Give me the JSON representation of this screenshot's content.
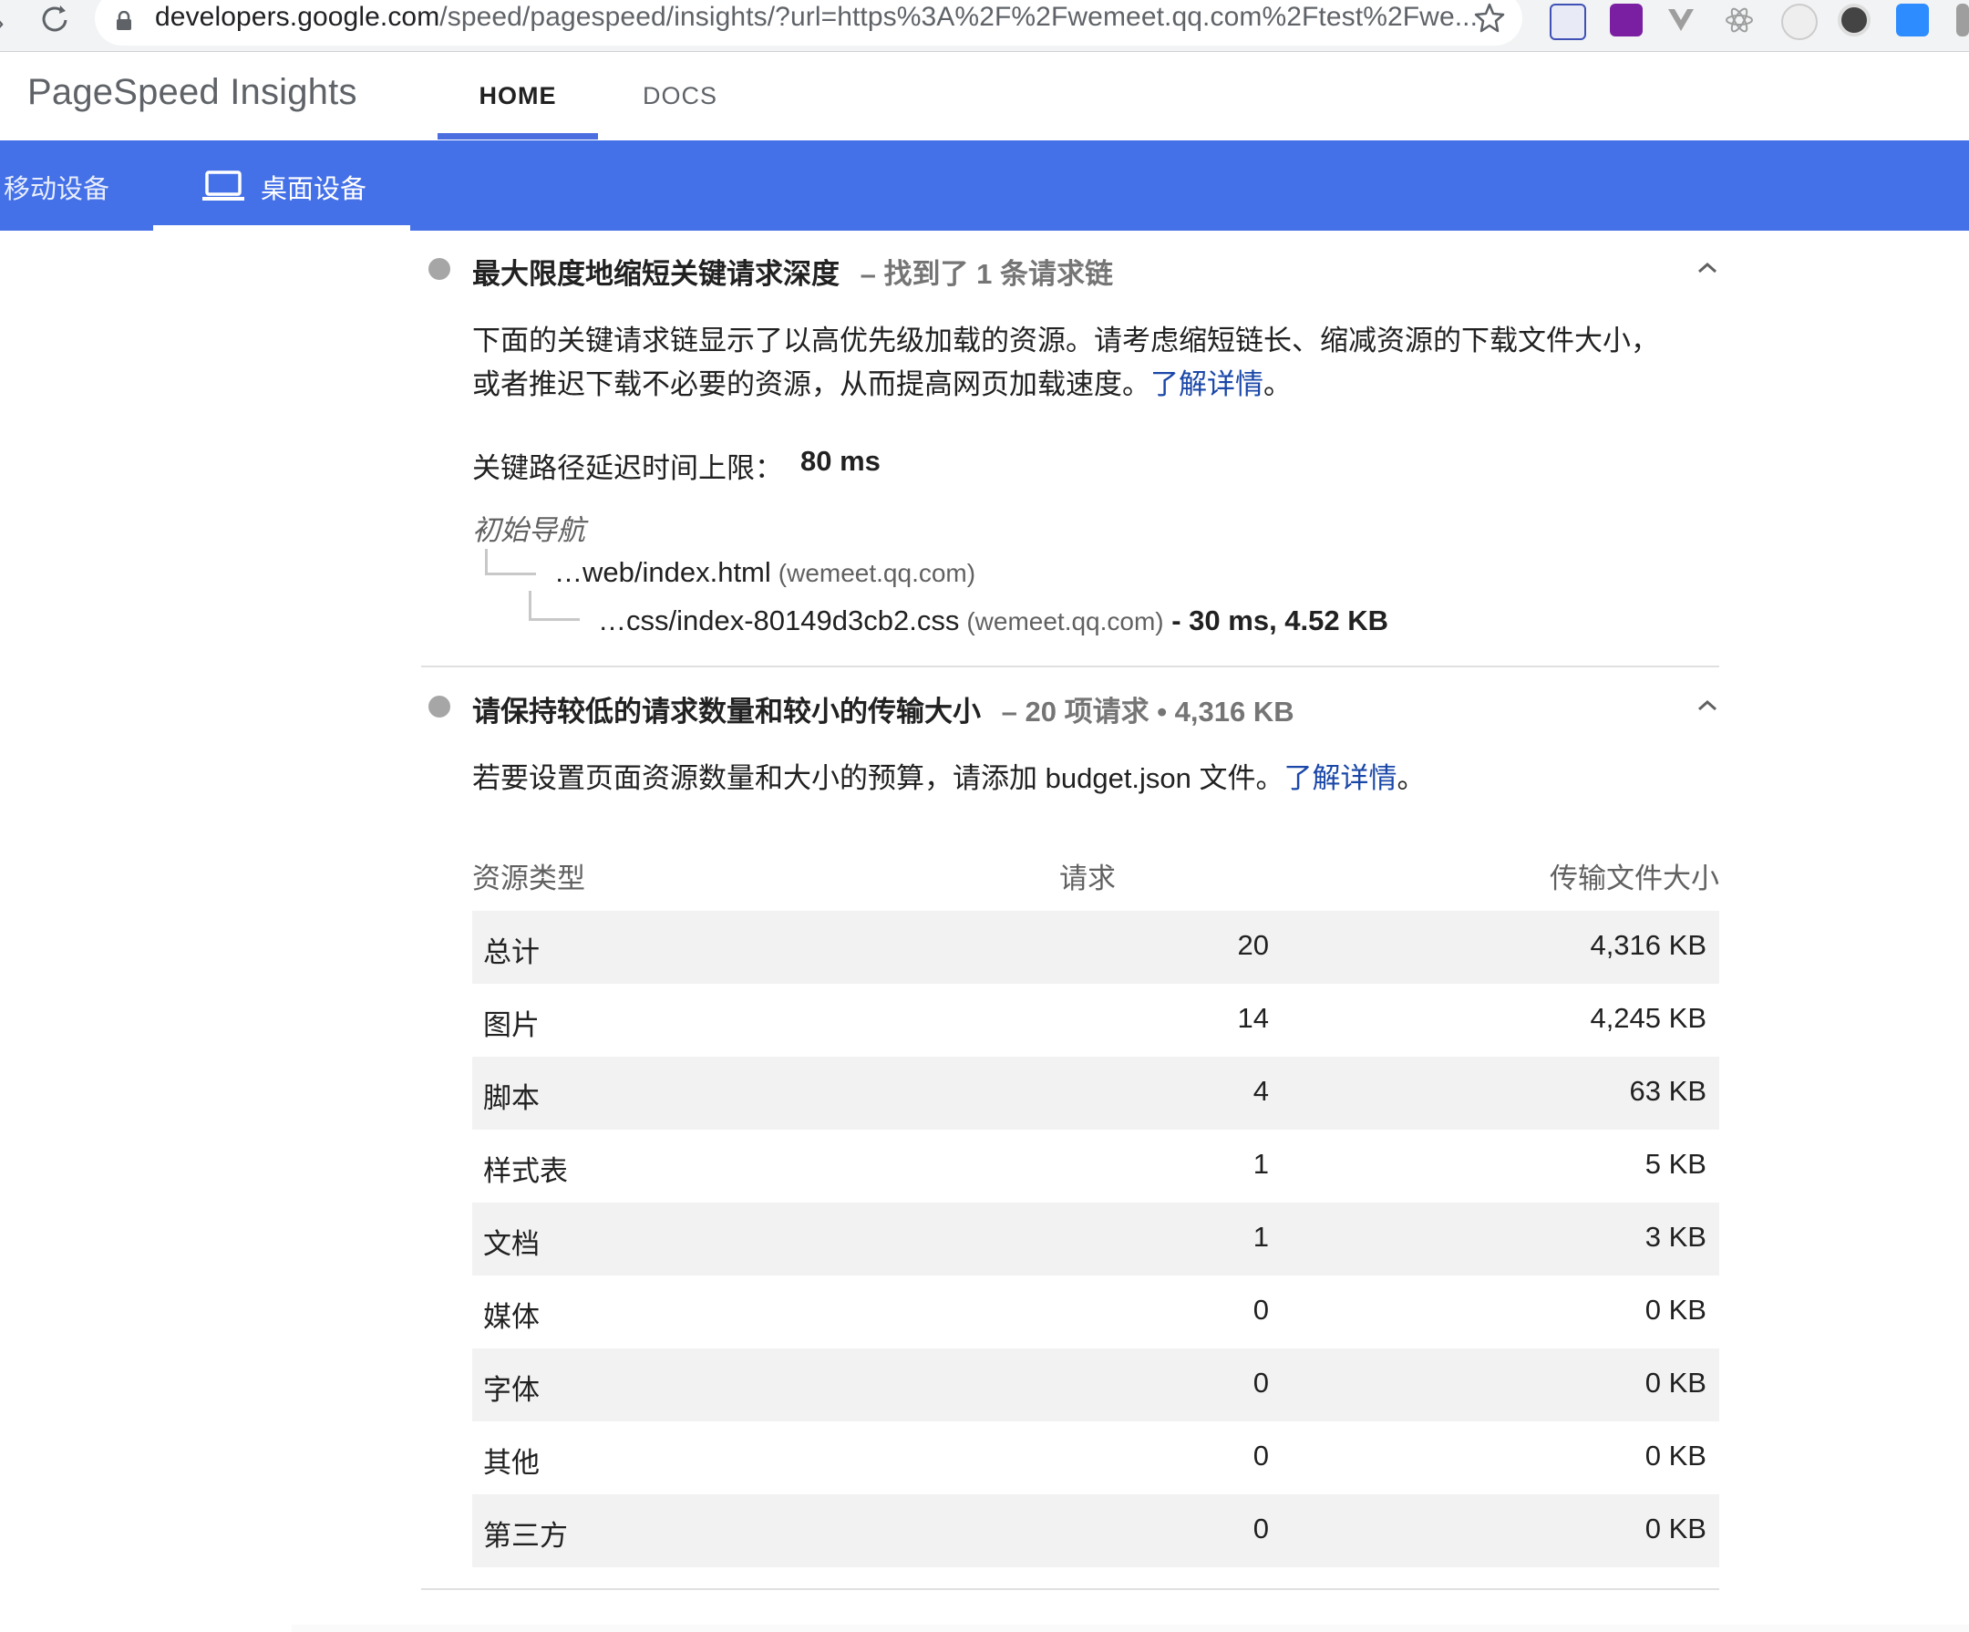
{
  "browser": {
    "url_host": "developers.google.com",
    "url_rest": "/speed/pagespeed/insights/?url=https%3A%2F%2Fwemeet.qq.com%2Ftest%2Fwe..."
  },
  "header": {
    "brand": "PageSpeed Insights",
    "tabs": [
      {
        "label": "HOME"
      },
      {
        "label": "DOCS"
      }
    ]
  },
  "device_bar": {
    "mobile_label": "移动设备",
    "desktop_label": "桌面设备"
  },
  "audit_chain": {
    "title": "最大限度地缩短关键请求深度",
    "separator": "–",
    "summary": "找到了 1 条请求链",
    "description_line1": "下面的关键请求链显示了以高优先级加载的资源。请考虑缩短链长、缩减资源的下载文件大小，",
    "description_line2": "或者推迟下载不必要的资源，从而提高网页加载速度。",
    "learn_more": "了解详情",
    "period": "。",
    "critical_label": "关键路径延迟时间上限：",
    "critical_value": "80 ms",
    "root_label": "初始导航",
    "nodes": [
      {
        "path": "…web/index.html",
        "host": "(wemeet.qq.com)",
        "stats": ""
      },
      {
        "path": "…css/index-80149d3cb2.css",
        "host": "(wemeet.qq.com)",
        "stats": " - 30 ms, 4.52 KB"
      }
    ]
  },
  "audit_budget": {
    "title": "请保持较低的请求数量和较小的传输大小",
    "separator": "–",
    "summary": "20 项请求 • 4,316 KB",
    "description": "若要设置页面资源数量和大小的预算，请添加 budget.json 文件。",
    "learn_more": "了解详情",
    "period": "。",
    "table": {
      "headers": [
        "资源类型",
        "请求",
        "传输文件大小"
      ],
      "rows": [
        {
          "type": "总计",
          "requests": "20",
          "size": "4,316 KB"
        },
        {
          "type": "图片",
          "requests": "14",
          "size": "4,245 KB"
        },
        {
          "type": "脚本",
          "requests": "4",
          "size": "63 KB"
        },
        {
          "type": "样式表",
          "requests": "1",
          "size": "5 KB"
        },
        {
          "type": "文档",
          "requests": "1",
          "size": "3 KB"
        },
        {
          "type": "媒体",
          "requests": "0",
          "size": "0 KB"
        },
        {
          "type": "字体",
          "requests": "0",
          "size": "0 KB"
        },
        {
          "type": "其他",
          "requests": "0",
          "size": "0 KB"
        },
        {
          "type": "第三方",
          "requests": "0",
          "size": "0 KB"
        }
      ]
    }
  },
  "colors": {
    "accent": "#4470e8",
    "link": "#1a47a8",
    "status_dot": "#a6a6a6"
  }
}
